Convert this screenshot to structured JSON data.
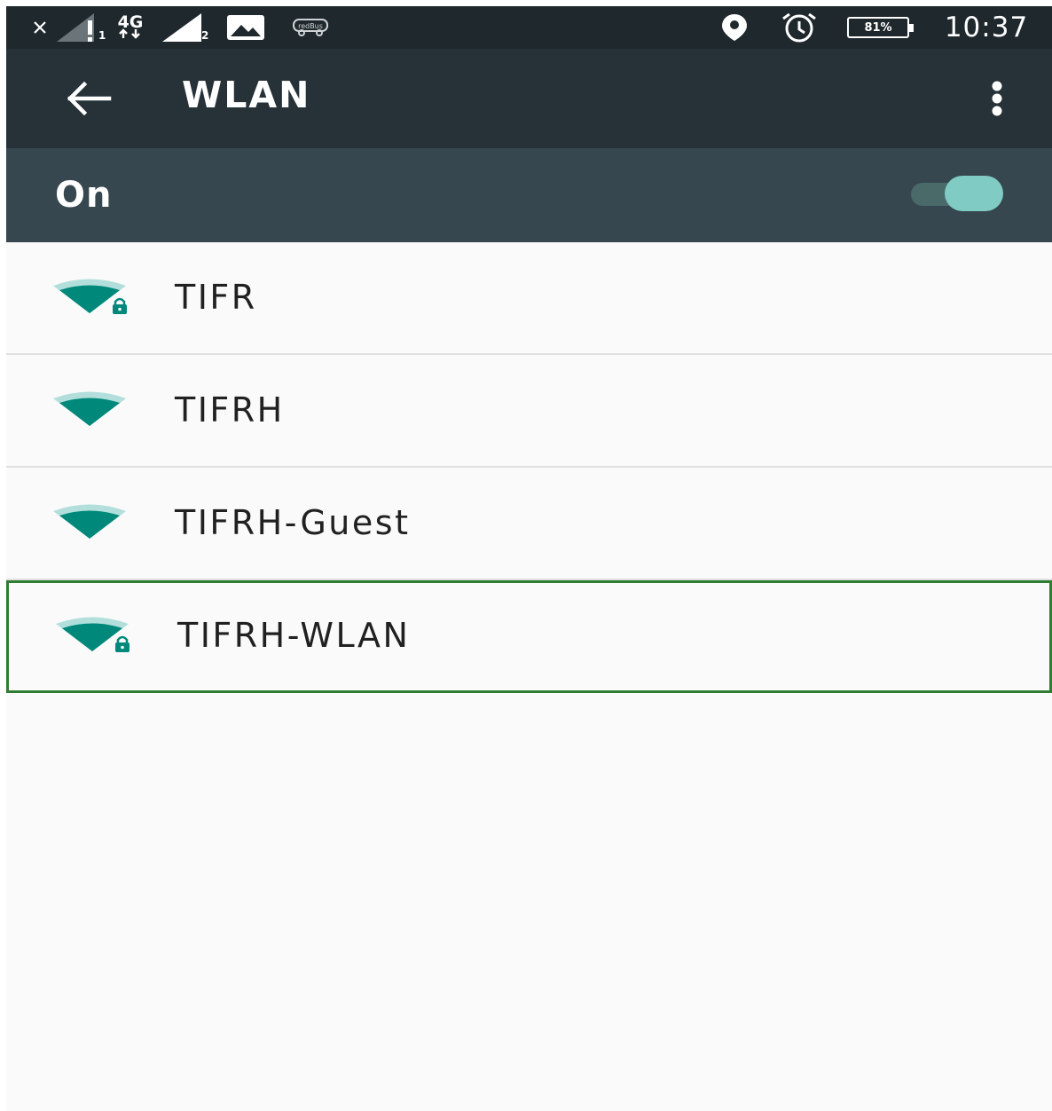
{
  "status_bar": {
    "icons": [
      "close-icon",
      "signal-no-sim-icon",
      "network-4g-icon",
      "signal-icon",
      "image-icon",
      "redbus-icon",
      "location-icon",
      "alarm-icon",
      "battery-icon"
    ],
    "sim1_label": "1",
    "network_type": "4G",
    "sim2_label": "2",
    "redbus_label": "redBus",
    "battery_percent": "81%",
    "time": "10:37"
  },
  "app_bar": {
    "title": "WLAN",
    "back_icon": "arrow-back-icon",
    "more_icon": "more-vert-icon"
  },
  "wlan_switch": {
    "label": "On",
    "enabled": true,
    "accent_color": "#80cbc4"
  },
  "networks": [
    {
      "ssid": "TIFR",
      "secured": true,
      "selected": false
    },
    {
      "ssid": "TIFRH",
      "secured": false,
      "selected": false
    },
    {
      "ssid": "TIFRH-Guest",
      "secured": false,
      "selected": false
    },
    {
      "ssid": "TIFRH-WLAN",
      "secured": true,
      "selected": true
    }
  ],
  "colors": {
    "status_bar": "#1f282d",
    "app_bar": "#263238",
    "switch_bar": "#37474f",
    "wifi_icon": "#00897b",
    "wifi_icon_dim": "#b2dfdb",
    "selection_outline": "#2e7d32"
  }
}
